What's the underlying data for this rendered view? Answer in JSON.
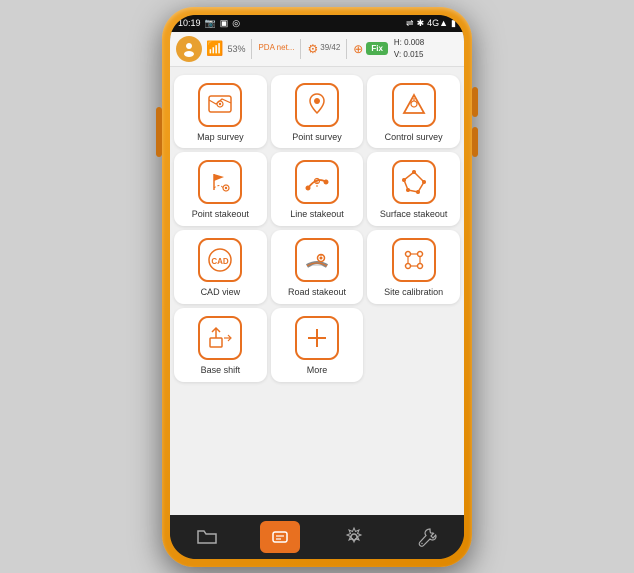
{
  "device": {
    "status_bar": {
      "time": "10:19",
      "icons_left": [
        "📷",
        "🔲",
        "◎"
      ],
      "icons_right": [
        "⇌",
        "✱",
        "4G▲",
        "🔋"
      ]
    },
    "info_bar": {
      "battery_pct": "53%",
      "pda_label": "PDA net...",
      "freq_label": "39/42",
      "fix_label": "Fix",
      "h_value": "H: 0.008",
      "v_value": "V: 0.015"
    },
    "grid_items": [
      {
        "id": "map-survey",
        "label": "Map survey",
        "icon": "map"
      },
      {
        "id": "point-survey",
        "label": "Point survey",
        "icon": "point"
      },
      {
        "id": "control-survey",
        "label": "Control survey",
        "icon": "triangle"
      },
      {
        "id": "point-stakeout",
        "label": "Point stakeout",
        "icon": "flag-point"
      },
      {
        "id": "line-stakeout",
        "label": "Line stakeout",
        "icon": "line"
      },
      {
        "id": "surface-stakeout",
        "label": "Surface stakeout",
        "icon": "surface"
      },
      {
        "id": "cad-view",
        "label": "CAD view",
        "icon": "cad"
      },
      {
        "id": "road-stakeout",
        "label": "Road stakeout",
        "icon": "road"
      },
      {
        "id": "site-calibration",
        "label": "Site calibration",
        "icon": "calibration"
      },
      {
        "id": "base-shift",
        "label": "Base shift",
        "icon": "shift"
      },
      {
        "id": "more",
        "label": "More",
        "icon": "plus"
      }
    ],
    "bottom_nav": [
      {
        "id": "nav-folder",
        "label": "folder",
        "active": false
      },
      {
        "id": "nav-tools",
        "label": "tools",
        "active": true
      },
      {
        "id": "nav-settings",
        "label": "settings",
        "active": false
      },
      {
        "id": "nav-wrench",
        "label": "wrench",
        "active": false
      }
    ]
  }
}
